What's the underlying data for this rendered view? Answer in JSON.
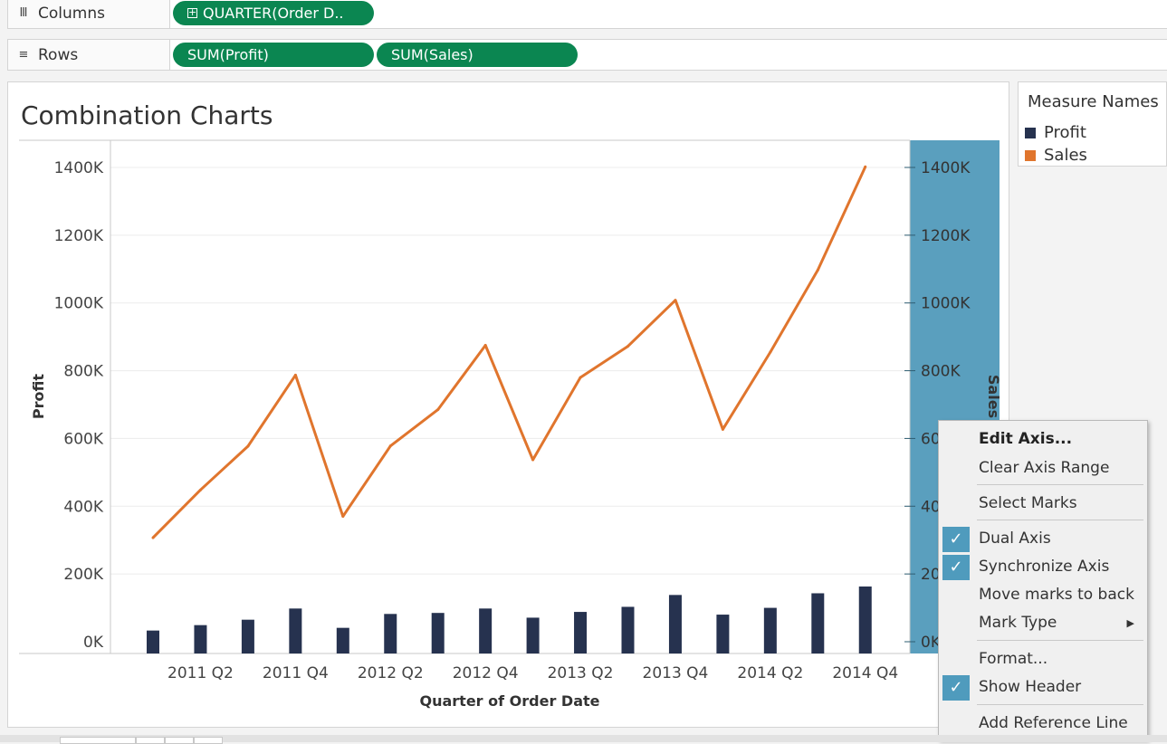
{
  "shelves": {
    "columns": {
      "label": "Columns",
      "icon": "columns-icon",
      "pills": [
        "QUARTER(Order D.."
      ]
    },
    "rows": {
      "label": "Rows",
      "icon": "rows-icon",
      "pills": [
        "SUM(Profit)",
        "SUM(Sales)"
      ]
    }
  },
  "chart": {
    "title": "Combination Charts"
  },
  "legend": {
    "title": "Measure Names",
    "items": [
      {
        "label": "Profit",
        "color": "#26324f"
      },
      {
        "label": "Sales",
        "color": "#e0752d"
      }
    ]
  },
  "context_menu": {
    "items": [
      {
        "label": "Edit Axis...",
        "bold": true,
        "checked": false
      },
      {
        "label": "Clear Axis Range",
        "checked": false
      },
      {
        "label": "Select Marks",
        "checked": false
      },
      {
        "label": "Dual Axis",
        "checked": true
      },
      {
        "label": "Synchronize Axis",
        "checked": true
      },
      {
        "label": "Move marks to back",
        "checked": false
      },
      {
        "label": "Mark Type",
        "checked": false,
        "submenu": true
      },
      {
        "label": "Format...",
        "checked": false
      },
      {
        "label": "Show Header",
        "checked": true
      },
      {
        "label": "Add Reference Line",
        "checked": false
      }
    ],
    "check_color": "#4f9bbd",
    "checkmark_icon": "checkmark-icon",
    "submenu_icon": "submenu-arrow-icon"
  },
  "chart_data": {
    "type": "bar+line",
    "xlabel": "Quarter of Order Date",
    "ylabel_left": "Profit",
    "ylabel_right": "Sales",
    "x_tick_labels": [
      "2011 Q2",
      "2011 Q4",
      "2012 Q2",
      "2012 Q4",
      "2013 Q2",
      "2013 Q4",
      "2014 Q2",
      "2014 Q4"
    ],
    "x": [
      "2011 Q1",
      "2011 Q2",
      "2011 Q3",
      "2011 Q4",
      "2012 Q1",
      "2012 Q2",
      "2012 Q3",
      "2012 Q4",
      "2013 Q1",
      "2013 Q2",
      "2013 Q3",
      "2013 Q4",
      "2014 Q1",
      "2014 Q2",
      "2014 Q3",
      "2014 Q4"
    ],
    "ylim": [
      0,
      1400000
    ],
    "y_ticks": [
      0,
      200000,
      400000,
      600000,
      800000,
      1000000,
      1200000,
      1400000
    ],
    "left_tick_labels": [
      "0K",
      "200K",
      "400K",
      "600K",
      "800K",
      "1000K",
      "1200K",
      "1400K"
    ],
    "right_tick_labels": [
      "0K",
      "20",
      "40",
      "60",
      "800K",
      "1000K",
      "1200K",
      "1400K"
    ],
    "right_axis_highlight": "#5a9fbe",
    "series": [
      {
        "name": "Profit",
        "mark": "bar",
        "color": "#26324f",
        "values": [
          33000,
          49000,
          65000,
          98000,
          41000,
          82000,
          85000,
          98000,
          71000,
          88000,
          103000,
          138000,
          80000,
          100000,
          143000,
          163000
        ]
      },
      {
        "name": "Sales",
        "mark": "line",
        "color": "#e0752d",
        "values": [
          307000,
          448000,
          577000,
          787000,
          370000,
          578000,
          685000,
          875000,
          537000,
          780000,
          872000,
          1008000,
          627000,
          855000,
          1097000,
          1402000
        ]
      }
    ],
    "grid": true
  }
}
